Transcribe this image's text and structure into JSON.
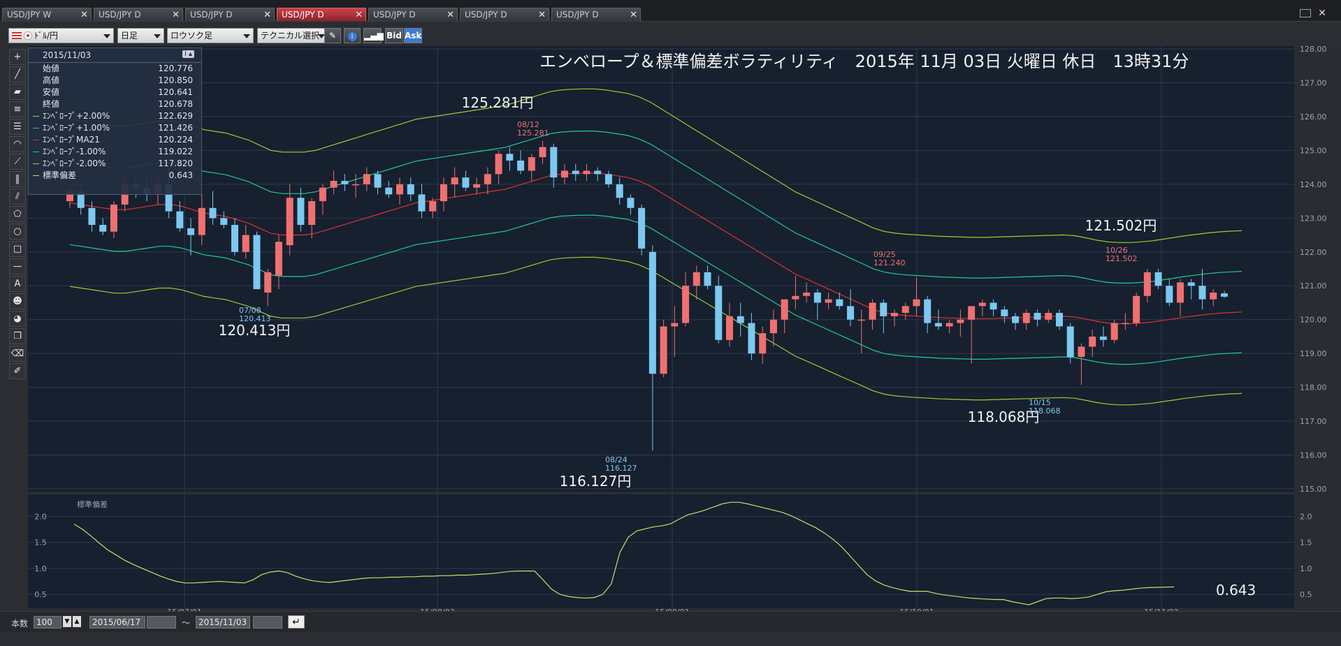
{
  "tabs": [
    {
      "label": "USD/JPY W",
      "active": false
    },
    {
      "label": "USD/JPY D",
      "active": false
    },
    {
      "label": "USD/JPY D",
      "active": false
    },
    {
      "label": "USD/JPY D",
      "active": true
    },
    {
      "label": "USD/JPY D",
      "active": false
    },
    {
      "label": "USD/JPY D",
      "active": false
    },
    {
      "label": "USD/JPY D",
      "active": false
    }
  ],
  "toolbar": {
    "pair": "ﾄﾞﾙ/円",
    "period": "日足",
    "style": "ロウソク足",
    "technical": "テクニカル選択",
    "bid": "Bid",
    "ask": "Ask"
  },
  "tools": [
    "plus-cross-icon",
    "line-icon",
    "ruler-icon",
    "hlines-icon",
    "multi-lines-icon",
    "arc-icon",
    "fan-icon",
    "vlines-icon",
    "channel-icon",
    "pentagon-icon",
    "circle-icon",
    "rect-icon",
    "hline-icon",
    "text-icon",
    "icon-stamp-icon",
    "paint-icon",
    "copy-icon",
    "eraser-icon",
    "settings-tool-icon"
  ],
  "info": {
    "date": "2015/11/03",
    "rows": [
      {
        "label": "始値",
        "value": "120.776",
        "color": ""
      },
      {
        "label": "高値",
        "value": "120.850",
        "color": ""
      },
      {
        "label": "安値",
        "value": "120.641",
        "color": ""
      },
      {
        "label": "終値",
        "value": "120.678",
        "color": ""
      },
      {
        "label": "ｴﾝﾍﾞﾛｰﾌﾟ+2.00%",
        "value": "122.629",
        "color": "#9acd32"
      },
      {
        "label": "ｴﾝﾍﾞﾛｰﾌﾟ+1.00%",
        "value": "121.426",
        "color": "#20c997"
      },
      {
        "label": "ｴﾝﾍﾞﾛｰﾌﾟMA21",
        "value": "120.224",
        "color": "#e03030"
      },
      {
        "label": "ｴﾝﾍﾞﾛｰﾌﾟ-1.00%",
        "value": "119.022",
        "color": "#20c997"
      },
      {
        "label": "ｴﾝﾍﾞﾛｰﾌﾟ-2.00%",
        "value": "117.820",
        "color": "#9acd32"
      },
      {
        "label": "標準偏差",
        "value": "0.643",
        "color": "#c6e06a"
      }
    ]
  },
  "chart_data": {
    "type": "candlestick",
    "title": "エンベロープ＆標準偏差ボラティリティ　2015年 11月 03日 火曜日 休日　13時31分",
    "y_axis": {
      "min": 115.0,
      "max": 128.0,
      "ticks": [
        "115.00",
        "116.00",
        "117.00",
        "118.00",
        "119.00",
        "120.00",
        "121.00",
        "122.00",
        "123.00",
        "124.00",
        "125.00",
        "126.00",
        "127.00",
        "128.00"
      ]
    },
    "x_ticks": [
      "15/07/01",
      "15/08/03",
      "15/09/01",
      "15/10/01",
      "15/11/02"
    ],
    "candle_colors": {
      "up": "#f07070",
      "down": "#7cc8f0"
    },
    "candles": [
      [
        123.5,
        124.0,
        123.3,
        123.8
      ],
      [
        123.8,
        124.0,
        123.1,
        123.3
      ],
      [
        123.3,
        123.5,
        122.6,
        122.8
      ],
      [
        122.8,
        123.0,
        122.5,
        122.6
      ],
      [
        122.6,
        123.5,
        122.4,
        123.4
      ],
      [
        123.4,
        124.2,
        123.2,
        124.0
      ],
      [
        124.0,
        124.3,
        123.6,
        123.9
      ],
      [
        123.9,
        124.2,
        123.5,
        123.7
      ],
      [
        123.7,
        124.3,
        123.4,
        124.0
      ],
      [
        124.0,
        124.5,
        123.0,
        123.2
      ],
      [
        123.2,
        123.5,
        122.6,
        122.7
      ],
      [
        122.7,
        123.0,
        121.9,
        122.5
      ],
      [
        122.5,
        123.7,
        122.2,
        123.3
      ],
      [
        123.3,
        123.8,
        122.8,
        123.0
      ],
      [
        123.0,
        123.2,
        122.7,
        122.8
      ],
      [
        122.8,
        123.0,
        121.9,
        122.0
      ],
      [
        122.0,
        122.8,
        121.8,
        122.5
      ],
      [
        122.5,
        122.6,
        120.9,
        120.9
      ],
      [
        120.8,
        121.5,
        120.4,
        121.4
      ],
      [
        121.3,
        122.5,
        120.9,
        122.3
      ],
      [
        122.2,
        124.0,
        121.9,
        123.6
      ],
      [
        123.6,
        123.9,
        122.6,
        122.8
      ],
      [
        122.8,
        123.6,
        122.4,
        123.5
      ],
      [
        123.5,
        124.0,
        123.1,
        123.9
      ],
      [
        123.9,
        124.4,
        123.7,
        124.1
      ],
      [
        124.1,
        124.3,
        123.8,
        124.0
      ],
      [
        124.0,
        124.3,
        123.6,
        124.0
      ],
      [
        124.0,
        124.5,
        123.8,
        124.3
      ],
      [
        124.3,
        124.4,
        123.7,
        123.9
      ],
      [
        123.9,
        124.1,
        123.6,
        123.7
      ],
      [
        123.7,
        124.2,
        123.4,
        124.0
      ],
      [
        124.0,
        124.2,
        123.5,
        123.7
      ],
      [
        123.7,
        124.0,
        123.0,
        123.2
      ],
      [
        123.2,
        123.6,
        123.0,
        123.5
      ],
      [
        123.5,
        124.2,
        123.2,
        124.0
      ],
      [
        124.0,
        124.5,
        123.6,
        124.2
      ],
      [
        124.2,
        124.4,
        123.8,
        123.9
      ],
      [
        123.9,
        124.2,
        123.7,
        124.0
      ],
      [
        124.0,
        124.5,
        123.7,
        124.3
      ],
      [
        124.3,
        125.0,
        124.0,
        124.9
      ],
      [
        124.9,
        125.1,
        124.4,
        124.7
      ],
      [
        124.7,
        125.0,
        124.3,
        124.4
      ],
      [
        124.4,
        124.9,
        124.1,
        124.8
      ],
      [
        124.8,
        125.281,
        124.6,
        125.1
      ],
      [
        125.1,
        125.2,
        123.9,
        124.2
      ],
      [
        124.2,
        124.6,
        124.0,
        124.4
      ],
      [
        124.4,
        124.6,
        124.1,
        124.3
      ],
      [
        124.3,
        124.6,
        124.1,
        124.4
      ],
      [
        124.4,
        124.5,
        124.1,
        124.3
      ],
      [
        124.3,
        124.4,
        123.9,
        124.0
      ],
      [
        124.0,
        124.2,
        123.4,
        123.6
      ],
      [
        123.6,
        123.7,
        123.1,
        123.3
      ],
      [
        123.3,
        123.4,
        121.9,
        122.1
      ],
      [
        122.0,
        122.2,
        116.127,
        118.4
      ],
      [
        118.4,
        120.0,
        118.3,
        119.8
      ],
      [
        119.8,
        120.4,
        118.9,
        119.9
      ],
      [
        119.9,
        121.4,
        119.8,
        121.0
      ],
      [
        121.0,
        121.6,
        120.6,
        121.4
      ],
      [
        121.4,
        121.6,
        120.9,
        121.0
      ],
      [
        121.0,
        121.3,
        119.3,
        119.4
      ],
      [
        119.4,
        120.5,
        119.2,
        120.1
      ],
      [
        120.1,
        120.5,
        119.5,
        119.9
      ],
      [
        119.9,
        120.2,
        118.8,
        119.0
      ],
      [
        119.0,
        119.8,
        118.7,
        119.6
      ],
      [
        119.6,
        120.3,
        119.2,
        120.0
      ],
      [
        120.0,
        120.6,
        119.6,
        120.6
      ],
      [
        120.6,
        121.3,
        120.3,
        120.7
      ],
      [
        120.7,
        121.1,
        120.5,
        120.8
      ],
      [
        120.8,
        120.9,
        120.0,
        120.5
      ],
      [
        120.5,
        120.8,
        120.3,
        120.6
      ],
      [
        120.6,
        120.8,
        120.3,
        120.4
      ],
      [
        120.4,
        120.9,
        119.8,
        120.0
      ],
      [
        120.0,
        120.3,
        119.0,
        120.0
      ],
      [
        120.0,
        120.6,
        119.7,
        120.5
      ],
      [
        120.5,
        120.6,
        119.6,
        120.1
      ],
      [
        120.1,
        120.3,
        119.8,
        120.2
      ],
      [
        120.2,
        120.5,
        120.0,
        120.4
      ],
      [
        120.4,
        121.24,
        120.1,
        120.6
      ],
      [
        120.6,
        120.7,
        119.6,
        119.9
      ],
      [
        119.9,
        120.3,
        119.7,
        119.8
      ],
      [
        119.8,
        120.0,
        119.6,
        119.9
      ],
      [
        119.9,
        120.3,
        119.5,
        120.0
      ],
      [
        120.0,
        120.2,
        118.7,
        120.4
      ],
      [
        120.4,
        120.6,
        120.1,
        120.5
      ],
      [
        120.5,
        120.6,
        120.1,
        120.3
      ],
      [
        120.3,
        120.4,
        119.9,
        120.1
      ],
      [
        120.1,
        120.2,
        119.7,
        119.9
      ],
      [
        119.9,
        120.3,
        119.7,
        120.2
      ],
      [
        120.2,
        120.3,
        119.8,
        120.0
      ],
      [
        120.0,
        120.3,
        119.9,
        120.2
      ],
      [
        120.2,
        120.3,
        119.7,
        119.8
      ],
      [
        119.8,
        119.9,
        118.7,
        118.9
      ],
      [
        118.9,
        119.3,
        118.068,
        119.2
      ],
      [
        119.2,
        119.7,
        118.9,
        119.5
      ],
      [
        119.5,
        119.8,
        119.2,
        119.4
      ],
      [
        119.4,
        120.0,
        119.3,
        119.9
      ],
      [
        119.9,
        120.2,
        119.7,
        119.9
      ],
      [
        119.9,
        120.8,
        119.8,
        120.7
      ],
      [
        120.7,
        121.5,
        120.5,
        121.4
      ],
      [
        121.4,
        121.502,
        120.9,
        121.0
      ],
      [
        121.0,
        121.2,
        120.4,
        120.5
      ],
      [
        120.5,
        121.2,
        120.1,
        121.1
      ],
      [
        121.1,
        121.2,
        120.6,
        121.0
      ],
      [
        121.0,
        121.5,
        120.3,
        120.6
      ],
      [
        120.6,
        120.9,
        120.4,
        120.8
      ],
      [
        120.776,
        120.85,
        120.641,
        120.678
      ]
    ],
    "envelope_ma21": [
      123.45,
      123.4,
      123.35,
      123.3,
      123.25,
      123.25,
      123.3,
      123.35,
      123.4,
      123.4,
      123.35,
      123.25,
      123.15,
      123.1,
      123.05,
      122.95,
      122.85,
      122.7,
      122.55,
      122.5,
      122.5,
      122.5,
      122.55,
      122.65,
      122.75,
      122.85,
      122.95,
      123.05,
      123.15,
      123.25,
      123.35,
      123.45,
      123.5,
      123.55,
      123.6,
      123.65,
      123.7,
      123.75,
      123.8,
      123.85,
      123.95,
      124.05,
      124.15,
      124.25,
      124.3,
      124.32,
      124.33,
      124.33,
      124.3,
      124.25,
      124.2,
      124.1,
      123.95,
      123.75,
      123.55,
      123.35,
      123.15,
      122.95,
      122.75,
      122.55,
      122.35,
      122.15,
      121.95,
      121.75,
      121.55,
      121.35,
      121.2,
      121.05,
      120.9,
      120.75,
      120.6,
      120.45,
      120.3,
      120.2,
      120.15,
      120.12,
      120.1,
      120.08,
      120.06,
      120.05,
      120.04,
      120.03,
      120.03,
      120.04,
      120.05,
      120.06,
      120.07,
      120.08,
      120.09,
      120.1,
      120.08,
      120.02,
      119.95,
      119.9,
      119.88,
      119.88,
      119.9,
      119.93,
      119.98,
      120.03,
      120.08,
      120.12,
      120.16,
      120.19,
      120.21,
      120.224
    ],
    "stddev": {
      "min": 0.3,
      "max": 2.3,
      "ticks": [
        "0.5",
        "1.0",
        "1.5",
        "2.0"
      ],
      "label": "標準偏差",
      "values": [
        1.85,
        1.75,
        1.62,
        1.48,
        1.35,
        1.25,
        1.15,
        1.07,
        1.0,
        0.93,
        0.86,
        0.8,
        0.75,
        0.72,
        0.72,
        0.73,
        0.74,
        0.75,
        0.74,
        0.73,
        0.72,
        0.78,
        0.88,
        0.93,
        0.95,
        0.92,
        0.85,
        0.8,
        0.76,
        0.74,
        0.73,
        0.75,
        0.77,
        0.79,
        0.81,
        0.82,
        0.82,
        0.83,
        0.83,
        0.84,
        0.84,
        0.85,
        0.85,
        0.86,
        0.86,
        0.87,
        0.87,
        0.88,
        0.89,
        0.9,
        0.92,
        0.94,
        0.95,
        0.95,
        0.95,
        0.78,
        0.6,
        0.5,
        0.46,
        0.44,
        0.43,
        0.44,
        0.5,
        0.7,
        1.3,
        1.6,
        1.72,
        1.76,
        1.8,
        1.82,
        1.86,
        1.95,
        2.03,
        2.07,
        2.12,
        2.18,
        2.24,
        2.27,
        2.27,
        2.24,
        2.2,
        2.16,
        2.12,
        2.08,
        2.02,
        1.94,
        1.86,
        1.78,
        1.68,
        1.56,
        1.42,
        1.24,
        1.06,
        0.88,
        0.76,
        0.68,
        0.63,
        0.59,
        0.56,
        0.56,
        0.56,
        0.52,
        0.49,
        0.47,
        0.45,
        0.43,
        0.42,
        0.41,
        0.4,
        0.4,
        0.36,
        0.33,
        0.3,
        0.36,
        0.42,
        0.43,
        0.43,
        0.42,
        0.43,
        0.45,
        0.5,
        0.55,
        0.57,
        0.58,
        0.6,
        0.62,
        0.63,
        0.635,
        0.64,
        0.643
      ]
    },
    "annotations": [
      {
        "text": "125.281円",
        "date": "08/12",
        "price": "125.281"
      },
      {
        "text": "120.413円",
        "date": "07/08",
        "price": "120.413"
      },
      {
        "text": "116.127円",
        "date": "08/24",
        "price": "116.127"
      },
      {
        "text": "121.502円",
        "date": "10/26",
        "price": "121.502"
      },
      {
        "text": "118.068円",
        "date": "10/15",
        "price": "118.068"
      },
      {
        "text": "",
        "date": "09/25",
        "price": "121.240"
      }
    ],
    "stddev_value_label": "0.643"
  },
  "bottom": {
    "count_label": "本数",
    "count": "100",
    "from_date": "2015/06/17",
    "tilde": "〜",
    "to_date": "2015/11/03"
  }
}
